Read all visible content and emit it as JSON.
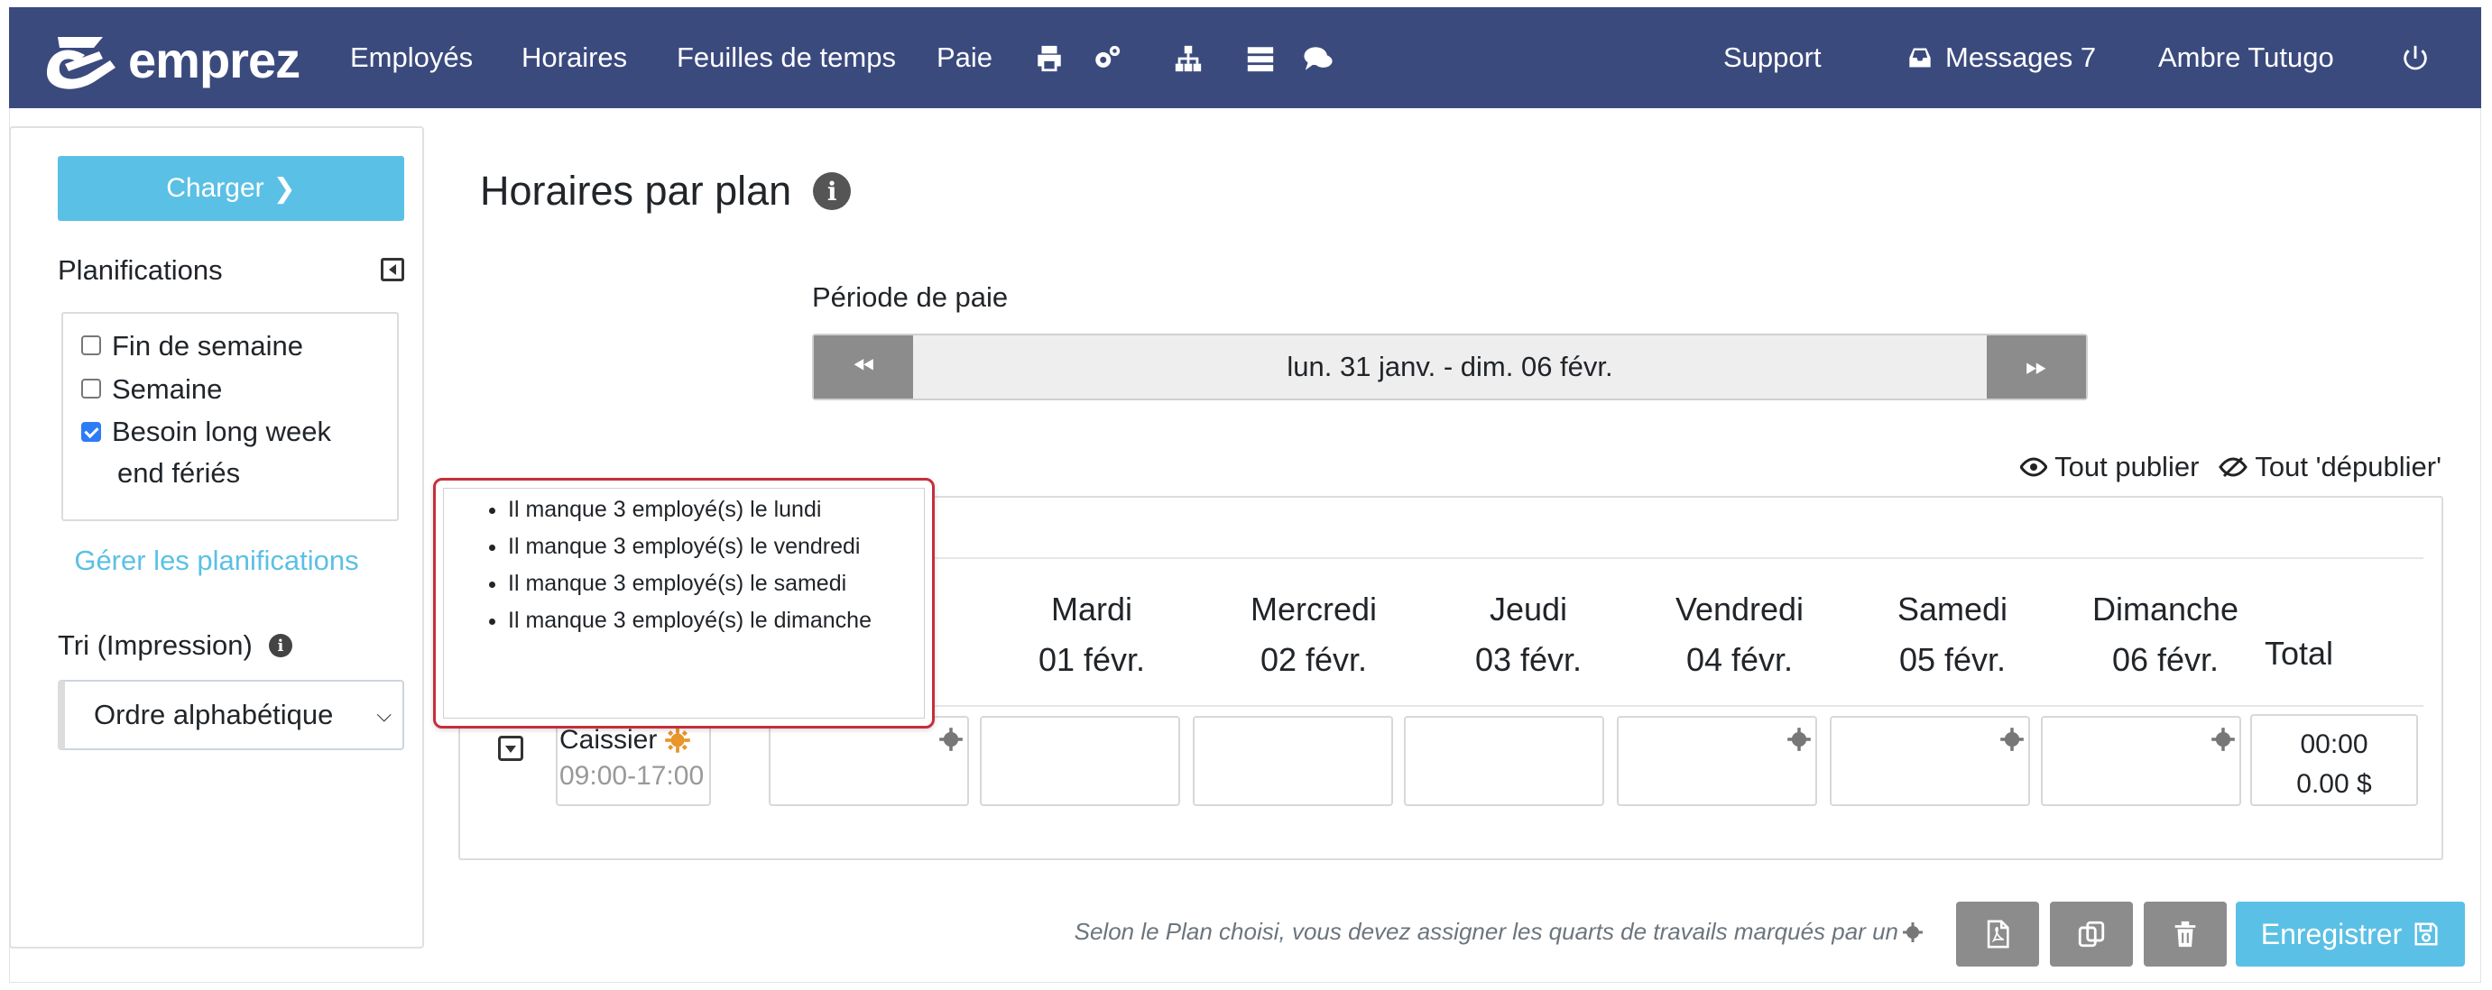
{
  "brand": {
    "name": "emprez"
  },
  "nav": {
    "links": [
      "Employés",
      "Horaires",
      "Feuilles de temps",
      "Paie"
    ],
    "icons": [
      "print-icon",
      "cogs-icon",
      "org-chart-icon",
      "server-icon",
      "comments-icon"
    ],
    "support": "Support",
    "messages": "Messages 7",
    "user": "Ambre Tutugo"
  },
  "sidebar": {
    "load_button": "Charger",
    "plans_title": "Planifications",
    "plans": [
      {
        "label": "Fin de semaine",
        "checked": false
      },
      {
        "label": "Semaine",
        "checked": false
      },
      {
        "label": "Besoin long week end fériés",
        "label_line1": "Besoin long week",
        "label_line2": "end fériés",
        "checked": true
      }
    ],
    "manage_link": "Gérer les planifications",
    "sort_label": "Tri (Impression)",
    "sort_value": "Ordre alphabétique"
  },
  "main": {
    "title": "Horaires par plan",
    "period_label": "Période de paie",
    "period_value": "lun. 31 janv. - dim. 06 févr.",
    "publish_all": "Tout publier",
    "unpublish_all": "Tout 'dépublier'",
    "days": [
      {
        "name": "Mardi",
        "date": "01 févr."
      },
      {
        "name": "Mercredi",
        "date": "02 févr."
      },
      {
        "name": "Jeudi",
        "date": "03 févr."
      },
      {
        "name": "Vendredi",
        "date": "04 févr."
      },
      {
        "name": "Samedi",
        "date": "05 févr."
      },
      {
        "name": "Dimanche",
        "date": "06 févr."
      }
    ],
    "total_header": "Total",
    "shift": {
      "name": "Caissier",
      "time": "09:00-17:00"
    },
    "totals": {
      "hours": "00:00",
      "amount": "0.00 $"
    }
  },
  "tooltip": {
    "items": [
      "Il manque 3 employé(s) le lundi",
      "Il manque 3 employé(s) le vendredi",
      "Il manque 3 employé(s) le samedi",
      "Il manque 3 employé(s) le dimanche"
    ]
  },
  "footer": {
    "note": "Selon le Plan choisi, vous devez assigner les quarts de travails marqués par un",
    "save_button": "Enregistrer"
  },
  "colors": {
    "navbar": "#3b4a7d",
    "accent": "#5bc0e5",
    "alert_border": "#c62f3a",
    "gear_orange": "#e8952a",
    "gear_grey": "#777777"
  }
}
